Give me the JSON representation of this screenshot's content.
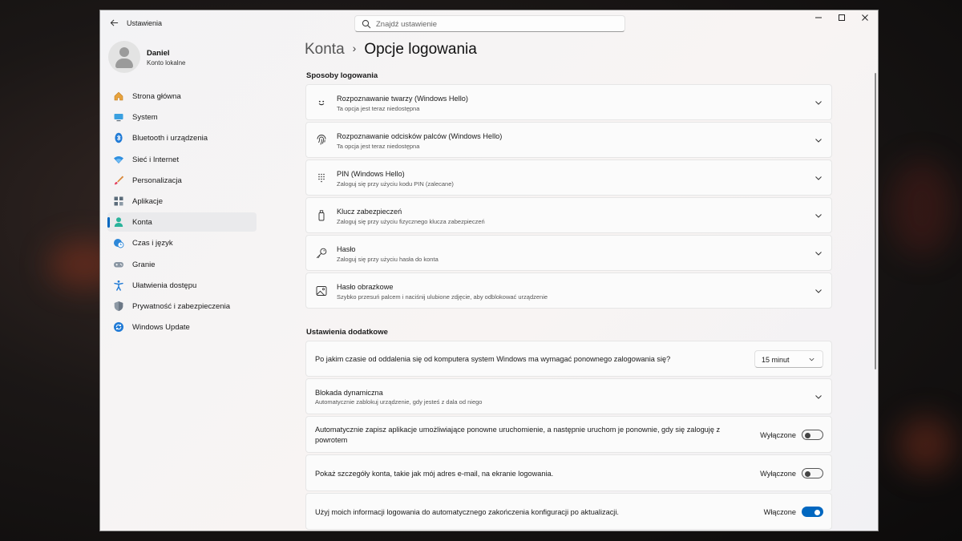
{
  "window": {
    "app_title": "Ustawienia",
    "search_placeholder": "Znajdź ustawienie"
  },
  "profile": {
    "name": "Daniel",
    "subtitle": "Konto lokalne"
  },
  "nav": {
    "items": [
      {
        "label": "Strona główna",
        "icon": "home-icon",
        "active": false
      },
      {
        "label": "System",
        "icon": "monitor-icon",
        "active": false
      },
      {
        "label": "Bluetooth i urządzenia",
        "icon": "bluetooth-icon",
        "active": false
      },
      {
        "label": "Sieć i Internet",
        "icon": "wifi-icon",
        "active": false
      },
      {
        "label": "Personalizacja",
        "icon": "brush-icon",
        "active": false
      },
      {
        "label": "Aplikacje",
        "icon": "apps-icon",
        "active": false
      },
      {
        "label": "Konta",
        "icon": "account-icon",
        "active": true
      },
      {
        "label": "Czas i język",
        "icon": "clock-globe-icon",
        "active": false
      },
      {
        "label": "Granie",
        "icon": "gamepad-icon",
        "active": false
      },
      {
        "label": "Ułatwienia dostępu",
        "icon": "accessibility-icon",
        "active": false
      },
      {
        "label": "Prywatność i zabezpieczenia",
        "icon": "shield-icon",
        "active": false
      },
      {
        "label": "Windows Update",
        "icon": "update-icon",
        "active": false
      }
    ]
  },
  "breadcrumb": {
    "parent": "Konta",
    "separator": "›",
    "current": "Opcje logowania"
  },
  "sign_in_methods": {
    "title": "Sposoby logowania",
    "items": [
      {
        "title": "Rozpoznawanie twarzy (Windows Hello)",
        "subtitle": "Ta opcja jest teraz niedostępna",
        "icon": "face-icon"
      },
      {
        "title": "Rozpoznawanie odcisków palców (Windows Hello)",
        "subtitle": "Ta opcja jest teraz niedostępna",
        "icon": "fingerprint-icon"
      },
      {
        "title": "PIN (Windows Hello)",
        "subtitle": "Zaloguj się przy użyciu kodu PIN (zalecane)",
        "icon": "pin-keypad-icon"
      },
      {
        "title": "Klucz zabezpieczeń",
        "subtitle": "Zaloguj się przy użyciu fizycznego klucza zabezpieczeń",
        "icon": "security-key-icon"
      },
      {
        "title": "Hasło",
        "subtitle": "Zaloguj się przy użyciu hasła do konta",
        "icon": "key-icon"
      },
      {
        "title": "Hasło obrazkowe",
        "subtitle": "Szybko przesuń palcem i naciśnij ulubione zdjęcie, aby odblokować urządzenie",
        "icon": "picture-icon"
      }
    ]
  },
  "additional_settings": {
    "title": "Ustawienia dodatkowe",
    "require_signin": {
      "text": "Po jakim czasie od oddalenia się od komputera system Windows ma wymagać ponownego zalogowania się?",
      "value": "15 minut"
    },
    "dynamic_lock": {
      "title": "Blokada dynamiczna",
      "subtitle": "Automatycznie zablokuj urządzenie, gdy jesteś z dala od niego"
    },
    "toggles": [
      {
        "text": "Automatycznie zapisz aplikacje umożliwiające ponowne uruchomienie, a następnie uruchom je ponownie, gdy się zaloguję z powrotem",
        "state": "Wyłączone",
        "on": false
      },
      {
        "text": "Pokaż szczegóły konta, takie jak mój adres e-mail, na ekranie logowania.",
        "state": "Wyłączone",
        "on": false
      },
      {
        "text": "Użyj moich informacji logowania do automatycznego zakończenia konfiguracji po aktualizacji.",
        "state": "Włączone",
        "on": true
      }
    ]
  },
  "colors": {
    "accent": "#0067c0",
    "window_bg": "#f3f3f5",
    "card_bg": "#fbfbfb"
  }
}
